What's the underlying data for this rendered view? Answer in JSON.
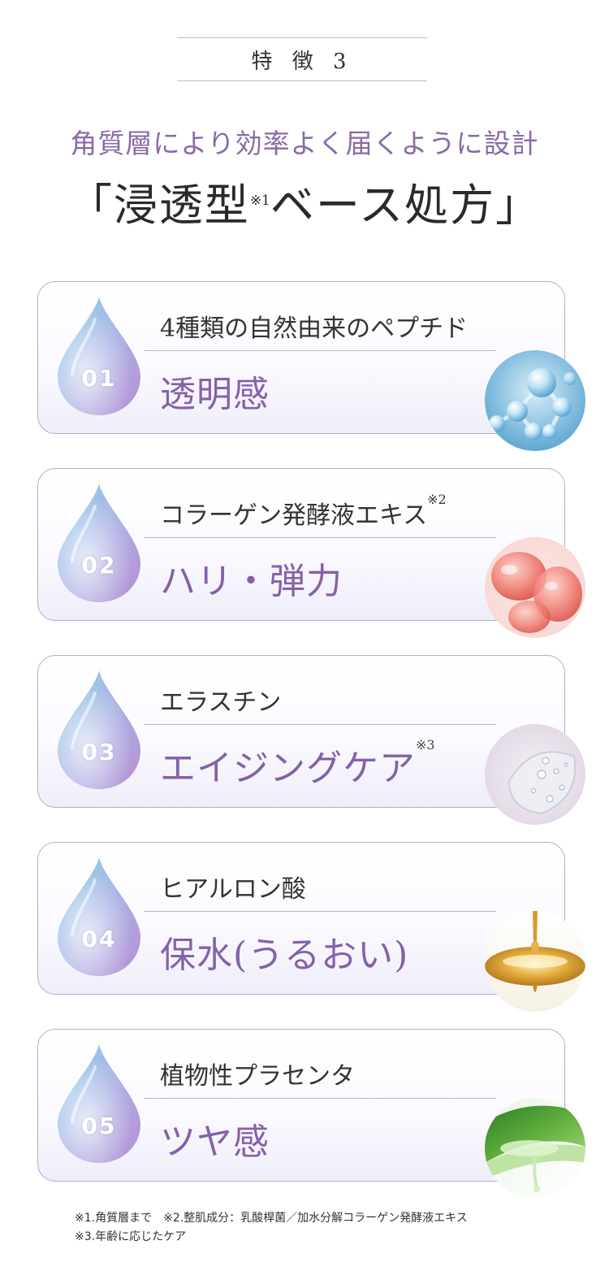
{
  "header": {
    "label": "特 徴 3"
  },
  "subtitle": "角質層により効率よく届くように設計",
  "title": {
    "text": "「浸透型",
    "sup": "※1",
    "text2": "ベース処方」"
  },
  "features": [
    {
      "num": "01",
      "kicker": "4種類の自然由来のペプチド",
      "kicker_sup": "",
      "benefit": "透明感",
      "benefit_sup": "",
      "photo": "molecule-photo"
    },
    {
      "num": "02",
      "kicker": "コラーゲン発酵液エキス",
      "kicker_sup": "※2",
      "benefit": "ハリ・弾力",
      "benefit_sup": "",
      "photo": "red-gel-photo"
    },
    {
      "num": "03",
      "kicker": "エラスチン",
      "kicker_sup": "",
      "benefit": "エイジングケア",
      "benefit_sup": "※3",
      "photo": "clear-gel-photo"
    },
    {
      "num": "04",
      "kicker": "ヒアルロン酸",
      "kicker_sup": "",
      "benefit": "保水(うるおい)",
      "benefit_sup": "",
      "photo": "golden-drop-photo"
    },
    {
      "num": "05",
      "kicker": "植物性プラセンタ",
      "kicker_sup": "",
      "benefit": "ツヤ感",
      "benefit_sup": "",
      "photo": "aloe-photo"
    }
  ],
  "notes": {
    "line1": "※1.角質層まで　※2.整肌成分：乳酸桿菌／加水分解コラーゲン発酵液エキス",
    "line2": "※3.年齢に応じたケア"
  },
  "colors": {
    "accent": "#8561a9",
    "subtitle": "#8a6aa6",
    "border": "#b7abc9"
  }
}
